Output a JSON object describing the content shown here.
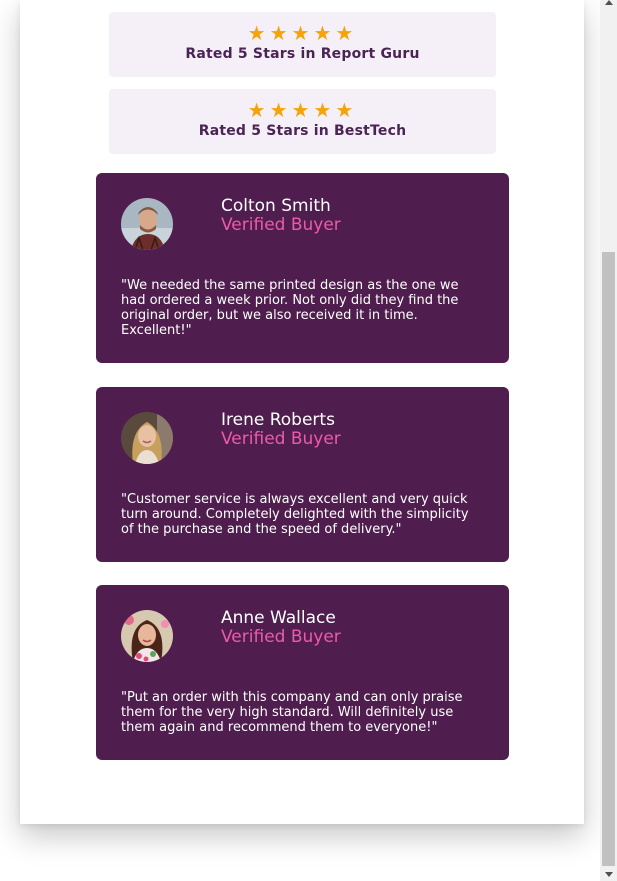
{
  "ratings": [
    {
      "stars": "★★★★★",
      "star_count": 5,
      "label": "Rated 5 Stars in Report Guru"
    },
    {
      "stars": "★★★★★",
      "star_count": 5,
      "label": "Rated 5 Stars in BestTech"
    }
  ],
  "reviews": [
    {
      "name": "Colton Smith",
      "role": "Verified Buyer",
      "text": "\"We needed the same printed design as the one we had ordered a week prior. Not only did they find the original order, but we also received it in time. Excellent!\""
    },
    {
      "name": "Irene Roberts",
      "role": "Verified Buyer",
      "text": "\"Customer service is always excellent and very quick turn around. Completely delighted with the simplicity of the purchase and the speed of delivery.\""
    },
    {
      "name": "Anne Wallace",
      "role": "Verified Buyer",
      "text": "\"Put an order with this company and can only praise them for the very high standard. Will definitely use them again and recommend them to everyone!\""
    }
  ],
  "colors": {
    "card_background": "#4f1e4e",
    "rating_background": "#f5f0f7",
    "star_color": "#f5a30b",
    "role_color": "#ee5aa8",
    "rating_text": "#4a2553"
  },
  "icons": [
    "star-icon",
    "avatar-photo",
    "scroll-up-arrow-icon",
    "scroll-down-arrow-icon"
  ]
}
